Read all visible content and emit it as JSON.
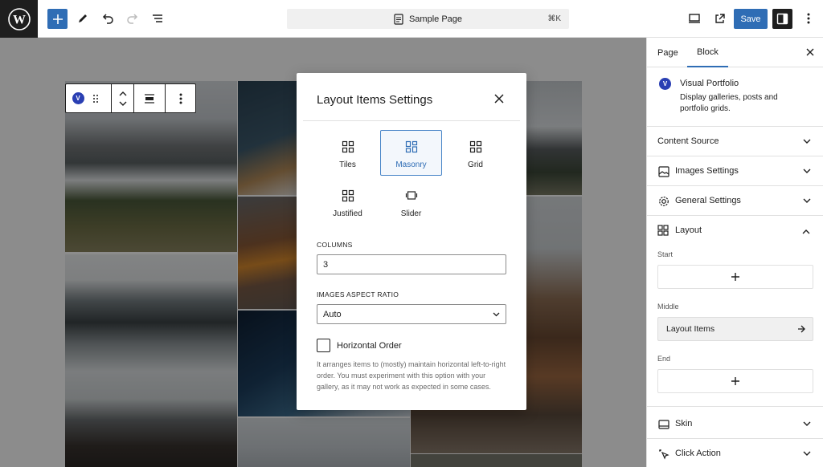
{
  "topbar": {
    "document_title": "Sample Page",
    "shortcut": "⌘K",
    "save_label": "Save"
  },
  "block_toolbar": {
    "badge": "V"
  },
  "modal": {
    "title": "Layout Items Settings",
    "layouts": [
      {
        "label": "Tiles",
        "active": false
      },
      {
        "label": "Masonry",
        "active": true
      },
      {
        "label": "Grid",
        "active": false
      },
      {
        "label": "Justified",
        "active": false
      },
      {
        "label": "Slider",
        "active": false
      }
    ],
    "columns_label": "COLUMNS",
    "columns_value": "3",
    "aspect_label": "IMAGES ASPECT RATIO",
    "aspect_value": "Auto",
    "horizontal_order_label": "Horizontal Order",
    "horizontal_order_checked": false,
    "help_text": "It arranges items to (mostly) maintain horizontal left-to-right order. You must experiment with this option with your gallery, as it may not work as expected in some cases."
  },
  "sidebar": {
    "tabs": [
      {
        "label": "Page",
        "active": false
      },
      {
        "label": "Block",
        "active": true
      }
    ],
    "block": {
      "badge": "V",
      "name": "Visual Portfolio",
      "description": "Display galleries, posts and portfolio grids."
    },
    "panels": [
      {
        "title": "Content Source",
        "icon": "none"
      },
      {
        "title": "Images Settings",
        "icon": "image-icon"
      },
      {
        "title": "General Settings",
        "icon": "gear-icon"
      },
      {
        "title": "Layout",
        "icon": "grid-icon",
        "expanded": true
      },
      {
        "title": "Skin",
        "icon": "skin-icon"
      },
      {
        "title": "Click Action",
        "icon": "cursor-click-icon"
      }
    ],
    "layout": {
      "start_label": "Start",
      "middle_label": "Middle",
      "end_label": "End",
      "middle_item": "Layout Items"
    }
  },
  "colors": {
    "accent": "#2f6db5",
    "dark": "#1e1e1e",
    "badge": "#2a3fb3"
  }
}
